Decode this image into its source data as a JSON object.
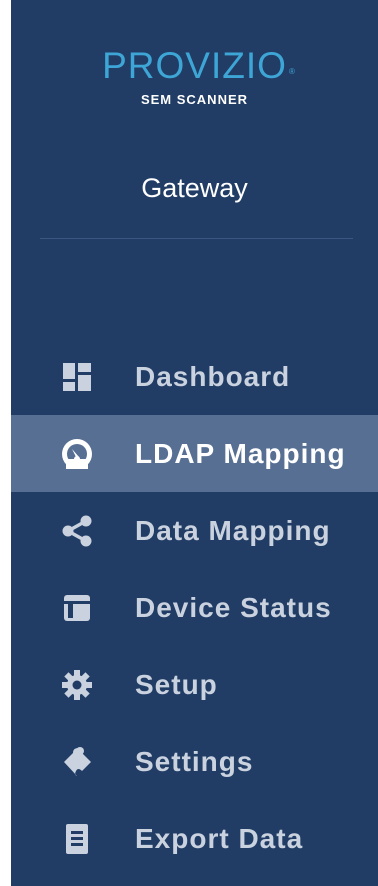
{
  "brand": {
    "name": "PROVIZIO",
    "registered": "®",
    "subtitle": "SEM SCANNER"
  },
  "gateway_title": "Gateway",
  "colors": {
    "sidebar_bg": "#213d66",
    "active_bg": "#566f93",
    "brand_blue": "#3ea6d6",
    "nav_text": "#c9d2de",
    "active_text": "#ffffff"
  },
  "nav": [
    {
      "label": "Dashboard",
      "icon": "dashboard-icon",
      "active": false
    },
    {
      "label": "LDAP Mapping",
      "icon": "ldap-gauge-icon",
      "active": true
    },
    {
      "label": "Data Mapping",
      "icon": "share-icon",
      "active": false
    },
    {
      "label": "Device Status",
      "icon": "layout-icon",
      "active": false
    },
    {
      "label": "Setup",
      "icon": "gear-icon",
      "active": false
    },
    {
      "label": "Settings",
      "icon": "puzzle-icon",
      "active": false
    },
    {
      "label": "Export Data",
      "icon": "document-icon",
      "active": false
    }
  ]
}
